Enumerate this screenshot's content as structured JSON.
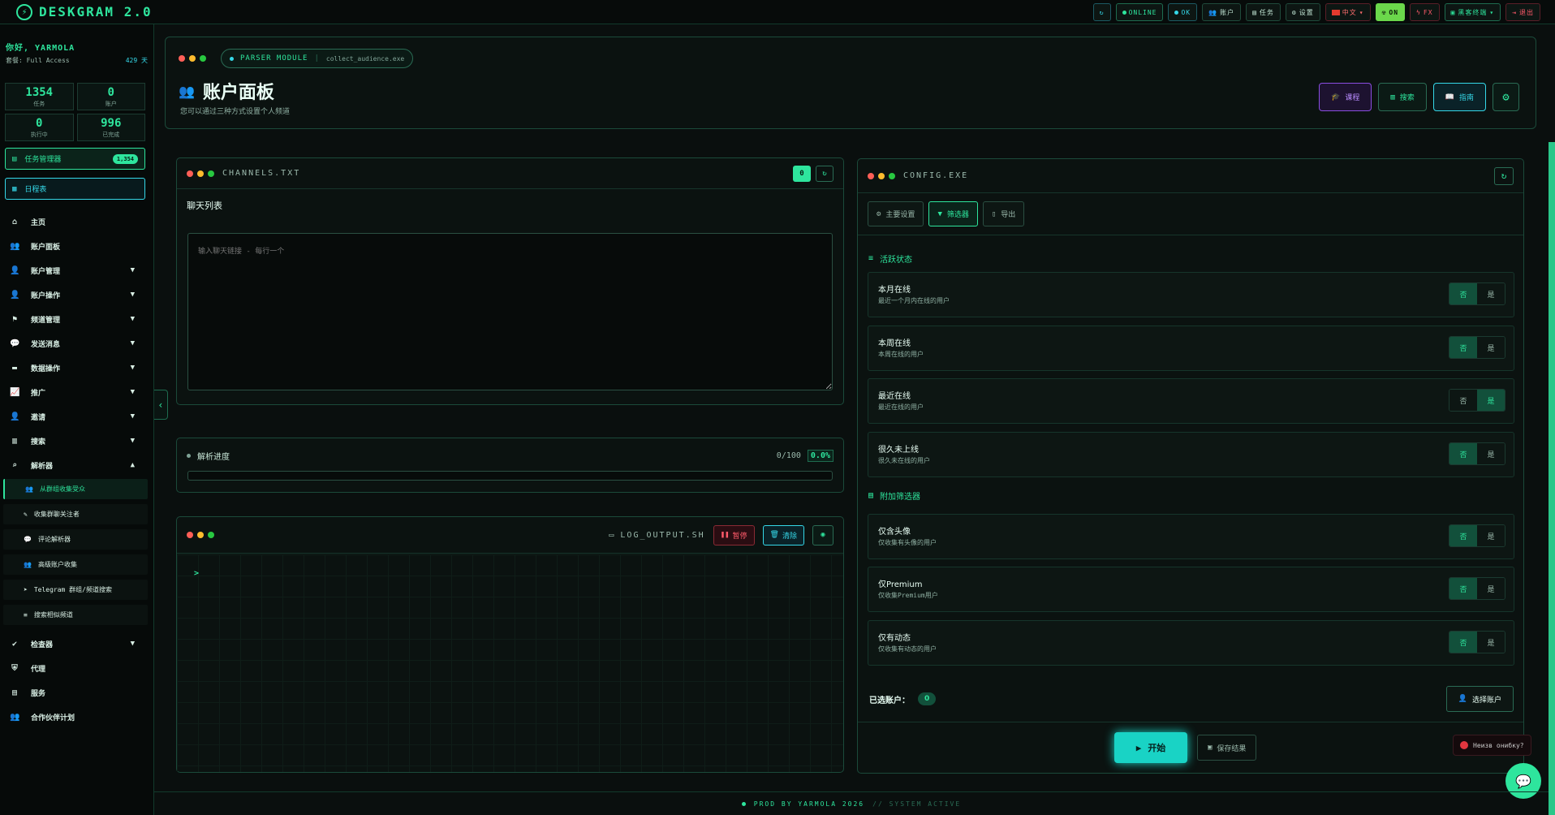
{
  "app": {
    "title": "DESKGRAM 2.0",
    "logo_icon": "rocket-icon"
  },
  "topbar": {
    "refresh_icon": "refresh-icon",
    "online": "ONLINE",
    "ok": "OK",
    "account": "账户",
    "tasks": "任务",
    "settings": "设置",
    "language": "中文",
    "on": "ON",
    "fx": "FX",
    "theme": "黑客终端",
    "logout": "退出"
  },
  "sidebar": {
    "greeting": "你好, YARMOLA",
    "plan_label": "套餐: Full Access",
    "days_left": "429 天",
    "stats": [
      {
        "value": "1354",
        "label": "任务"
      },
      {
        "value": "0",
        "label": "账户"
      },
      {
        "value": "0",
        "label": "执行中"
      },
      {
        "value": "996",
        "label": "已完成"
      }
    ],
    "task_manager": {
      "label": "任务管理器",
      "badge": "1,354"
    },
    "calendar": {
      "label": "日程表"
    },
    "nav": [
      {
        "label": "主页",
        "icon": "home-icon",
        "has_chevron": false
      },
      {
        "label": "账户面板",
        "icon": "users-icon",
        "has_chevron": false
      },
      {
        "label": "账户管理",
        "icon": "user-gear-icon",
        "has_chevron": true
      },
      {
        "label": "账户操作",
        "icon": "user-action-icon",
        "has_chevron": true
      },
      {
        "label": "频道管理",
        "icon": "flag-icon",
        "has_chevron": true
      },
      {
        "label": "发送消息",
        "icon": "chat-icon",
        "has_chevron": true
      },
      {
        "label": "数据操作",
        "icon": "briefcase-icon",
        "has_chevron": true
      },
      {
        "label": "推广",
        "icon": "chart-icon",
        "has_chevron": true
      },
      {
        "label": "邀请",
        "icon": "invite-icon",
        "has_chevron": true
      },
      {
        "label": "搜索",
        "icon": "building-icon",
        "has_chevron": true
      },
      {
        "label": "解析器",
        "icon": "search-icon",
        "has_chevron": true,
        "expanded": true
      }
    ],
    "sub_items": [
      {
        "label": "从群组收集受众",
        "icon": "users-icon",
        "active": true
      },
      {
        "label": "收集群聊关注者",
        "icon": "pen-icon",
        "active": false
      },
      {
        "label": "评论解析器",
        "icon": "comment-icon",
        "active": false
      },
      {
        "label": "高级账户收集",
        "icon": "user-group-icon",
        "active": false
      },
      {
        "label": "Telegram 群组/频道搜索",
        "icon": "telegram-icon",
        "active": false
      },
      {
        "label": "搜索相似频道",
        "icon": "database-icon",
        "active": false
      }
    ],
    "nav_bottom": [
      {
        "label": "检查器",
        "icon": "check-circle-icon",
        "has_chevron": true
      },
      {
        "label": "代理",
        "icon": "shield-icon",
        "has_chevron": false
      },
      {
        "label": "服务",
        "icon": "server-icon",
        "has_chevron": false
      },
      {
        "label": "合作伙伴计划",
        "icon": "partners-icon",
        "has_chevron": false
      }
    ]
  },
  "header": {
    "module_label": "PARSER MODULE",
    "module_file": "collect_audience.exe",
    "title": "账户面板",
    "subtitle": "您可以通过三种方式设置个人频道",
    "buttons": {
      "course": "课程",
      "search": "搜索",
      "guide": "指南"
    }
  },
  "channels": {
    "title": "CHANNELS.TXT",
    "label": "聊天列表",
    "placeholder": "输入聊天链接 - 每行一个",
    "count_badge": "0"
  },
  "progress": {
    "label": "解析进度",
    "count": "0/100",
    "percent_text": "0.0%",
    "percent": 0
  },
  "logs": {
    "file": "LOG_OUTPUT.SH",
    "pause": "暂停",
    "clear": "清除",
    "prompt": ">"
  },
  "config": {
    "title": "CONFIG.EXE",
    "tabs": [
      {
        "label": "主要设置",
        "icon": "gear-icon",
        "active": false
      },
      {
        "label": "筛选器",
        "icon": "filter-icon",
        "active": true
      },
      {
        "label": "导出",
        "icon": "export-icon",
        "active": false
      }
    ],
    "activity_heading": "活跃状态",
    "activity_options": [
      {
        "title": "本月在线",
        "desc": "最近一个月内在线的用户",
        "yes": "否",
        "no": "是",
        "selected": "yes"
      },
      {
        "title": "本周在线",
        "desc": "本周在线的用户",
        "yes": "否",
        "no": "是",
        "selected": "yes"
      },
      {
        "title": "最近在线",
        "desc": "最近在线的用户",
        "yes": "否",
        "no": "是",
        "selected": "no"
      },
      {
        "title": "很久未上线",
        "desc": "很久未在线的用户",
        "yes": "否",
        "no": "是",
        "selected": "yes"
      }
    ],
    "extra_heading": "附加筛选器",
    "extra_options": [
      {
        "title": "仅含头像",
        "desc": "仅收集有头像的用户",
        "yes": "否",
        "no": "是",
        "selected": "yes"
      },
      {
        "title": "仅Premium",
        "desc": "仅收集Premium用户",
        "yes": "否",
        "no": "是",
        "selected": "yes"
      },
      {
        "title": "仅有动态",
        "desc": "仅收集有动态的用户",
        "yes": "否",
        "no": "是",
        "selected": "yes"
      }
    ],
    "selected_accounts_label": "已选账户：",
    "selected_accounts_count": "0",
    "choose_accounts": "选择账户",
    "start": "开始",
    "save_result": "保存结果"
  },
  "toast": {
    "text": "Неизв онибку?"
  },
  "footer": {
    "credit": "PROD BY YARMOLA 2026",
    "status": "// SYSTEM ACTIVE"
  },
  "colors": {
    "accent": "#2ee59d",
    "cyan": "#35d8e8",
    "danger": "#ff5a6a",
    "purple": "#b98cff",
    "background": "#0a0f0e"
  }
}
